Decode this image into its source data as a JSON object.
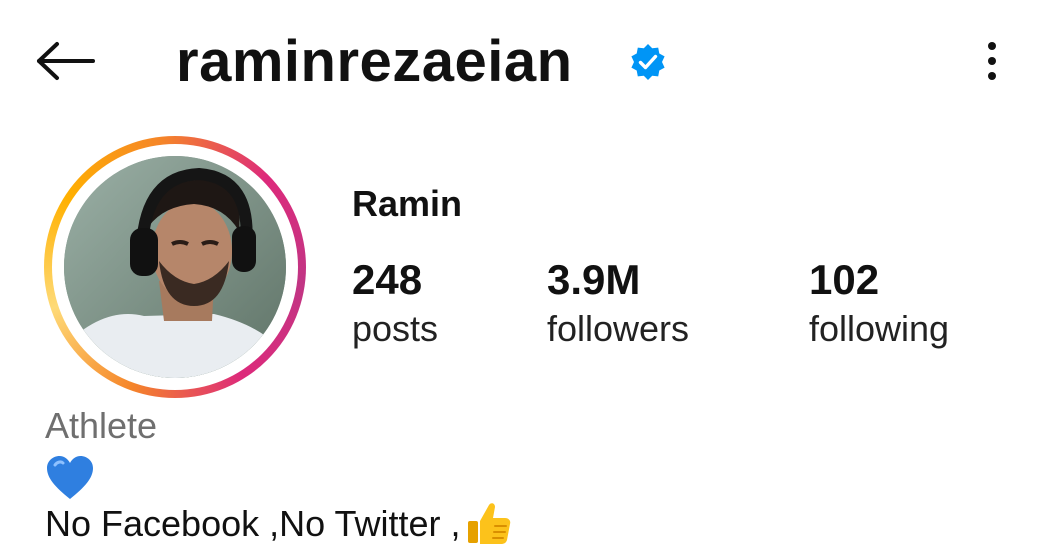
{
  "header": {
    "back_icon": "arrow-left-icon",
    "username": "raminrezaeian",
    "verified_icon": "verified-badge-icon",
    "more_icon": "more-vertical-icon"
  },
  "profile": {
    "display_name": "Ramin",
    "avatar_icon": "profile-photo-with-story-ring",
    "stats": {
      "posts": {
        "value": "248",
        "label": "posts"
      },
      "followers": {
        "value": "3.9M",
        "label": "followers"
      },
      "following": {
        "value": "102",
        "label": "following"
      }
    },
    "category": "Athlete",
    "bio": {
      "line1_emoji": "blue-heart-icon",
      "line2_text": "No Facebook ,No Twitter ,",
      "line2_emoji": "thumbs-up-icon"
    }
  },
  "colors": {
    "verified_blue": "#0095f6",
    "text_primary": "#111111",
    "text_secondary": "#6f6f6f",
    "ring_pink": "#dd2a7b",
    "ring_orange": "#f58529",
    "ring_yellow": "#feda77"
  }
}
